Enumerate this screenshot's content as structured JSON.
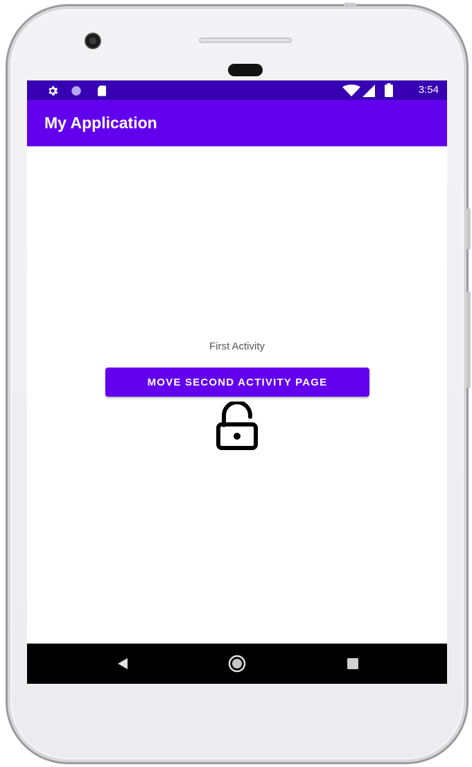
{
  "status_bar": {
    "time": "3:54",
    "icons_left": [
      "settings-icon",
      "circle-icon",
      "sd-card-icon"
    ],
    "icons_right": [
      "wifi-icon",
      "cell-signal-icon",
      "battery-icon"
    ],
    "color": "#3700b3"
  },
  "app_bar": {
    "title": "My Application",
    "color": "#6200ee"
  },
  "main": {
    "label": "First Activity",
    "button_label": "MOVE SECOND ACTIVITY PAGE",
    "image_icon": "unlocked-padlock-icon"
  },
  "nav_bar": {
    "buttons": [
      "back-icon",
      "home-icon",
      "recents-icon"
    ]
  }
}
